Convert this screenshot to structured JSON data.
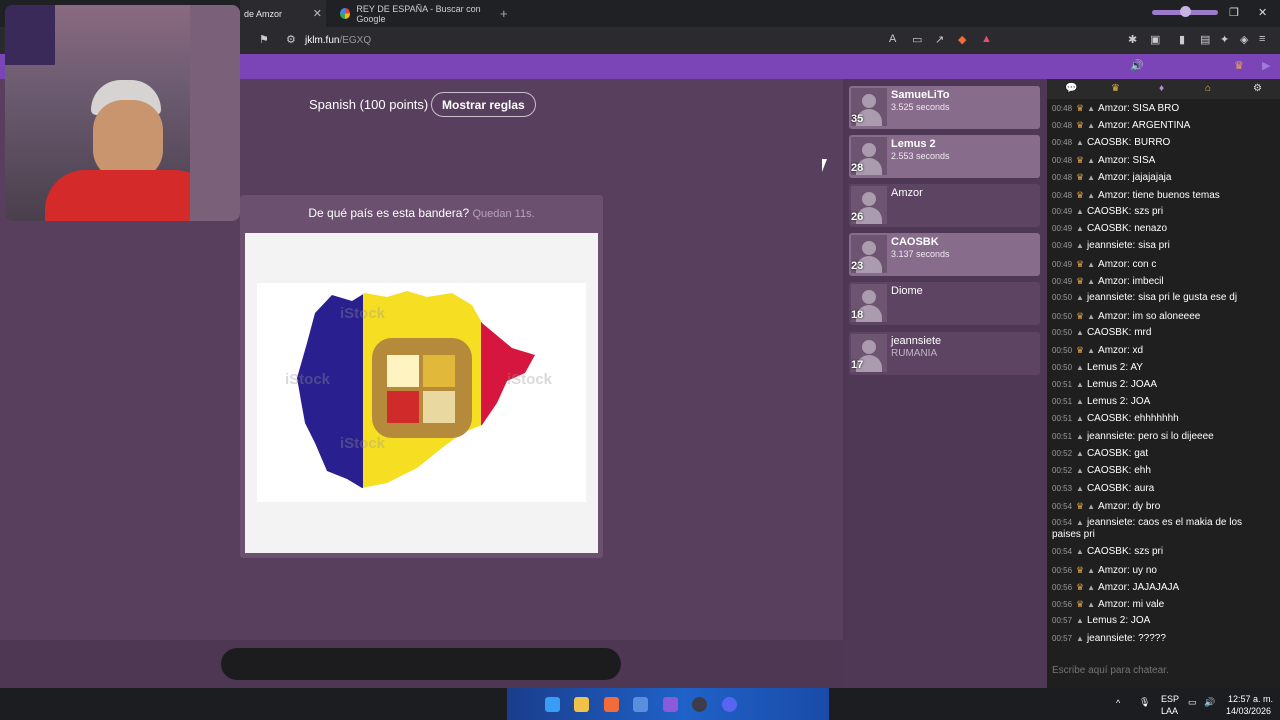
{
  "browser": {
    "tabs": [
      {
        "title": "de Amzor",
        "active": true
      },
      {
        "title": "REY DE ESPAÑA - Buscar con Google",
        "active": false
      }
    ],
    "url_host": "jklm.fun",
    "url_path": "/EGXQ"
  },
  "game": {
    "language_label": "Spanish (100 points)",
    "rules_button": "Mostrar reglas",
    "question": "De qué país es esta bandera?",
    "timer": "Quedan 11s.",
    "image_watermark": "iStock",
    "answer_input_placeholder": ""
  },
  "players": [
    {
      "name": "SamueLiTo",
      "detail": "3.525 seconds",
      "score": "35",
      "answered": true
    },
    {
      "name": "Lemus 2",
      "detail": "2.553 seconds",
      "score": "28",
      "answered": true
    },
    {
      "name": "Amzor",
      "detail": "",
      "score": "26",
      "answered": false
    },
    {
      "name": "CAOSBK",
      "detail": "3.137 seconds",
      "score": "23",
      "answered": true
    },
    {
      "name": "Diome",
      "detail": "",
      "score": "18",
      "answered": false
    },
    {
      "name": "jeannsiete",
      "detail": "RUMANIA",
      "score": "17",
      "answered": false
    }
  ],
  "chat": {
    "messages": [
      {
        "time": "00:48",
        "crown": true,
        "user": "Amzor",
        "text": "SISA BRO"
      },
      {
        "time": "00:48",
        "crown": true,
        "user": "Amzor",
        "text": "ARGENTINA"
      },
      {
        "time": "00:48",
        "crown": false,
        "user": "CAOSBK",
        "text": "BURRO"
      },
      {
        "time": "00:48",
        "crown": true,
        "user": "Amzor",
        "text": "SISA"
      },
      {
        "time": "00:48",
        "crown": true,
        "user": "Amzor",
        "text": "jajajajaja"
      },
      {
        "time": "00:48",
        "crown": true,
        "user": "Amzor",
        "text": "tiene buenos temas"
      },
      {
        "time": "00:49",
        "crown": false,
        "user": "CAOSBK",
        "text": "szs pri"
      },
      {
        "time": "00:49",
        "crown": false,
        "user": "CAOSBK",
        "text": "nenazo"
      },
      {
        "time": "00:49",
        "crown": false,
        "user": "jeannsiete",
        "text": "sisa pri"
      },
      {
        "time": "00:49",
        "crown": true,
        "user": "Amzor",
        "text": "con c"
      },
      {
        "time": "00:49",
        "crown": true,
        "user": "Amzor",
        "text": "imbecil"
      },
      {
        "time": "00:50",
        "crown": false,
        "user": "jeannsiete",
        "text": "sisa pri le gusta ese dj"
      },
      {
        "time": "00:50",
        "crown": true,
        "user": "Amzor",
        "text": "im so aloneeee"
      },
      {
        "time": "00:50",
        "crown": false,
        "user": "CAOSBK",
        "text": "mrd"
      },
      {
        "time": "00:50",
        "crown": true,
        "user": "Amzor",
        "text": "xd"
      },
      {
        "time": "00:50",
        "crown": false,
        "user": "Lemus 2",
        "text": "AY"
      },
      {
        "time": "00:51",
        "crown": false,
        "user": "Lemus 2",
        "text": "JOAA"
      },
      {
        "time": "00:51",
        "crown": false,
        "user": "Lemus 2",
        "text": "JOA"
      },
      {
        "time": "00:51",
        "crown": false,
        "user": "CAOSBK",
        "text": "ehhhhhhh"
      },
      {
        "time": "00:51",
        "crown": false,
        "user": "jeannsiete",
        "text": "pero si lo dijeeee"
      },
      {
        "time": "00:52",
        "crown": false,
        "user": "CAOSBK",
        "text": "gat"
      },
      {
        "time": "00:52",
        "crown": false,
        "user": "CAOSBK",
        "text": "ehh"
      },
      {
        "time": "00:53",
        "crown": false,
        "user": "CAOSBK",
        "text": "aura"
      },
      {
        "time": "00:54",
        "crown": true,
        "user": "Amzor",
        "text": "dy bro"
      },
      {
        "time": "00:54",
        "crown": false,
        "user": "jeannsiete",
        "text": "caos es el makia de los paises pri"
      },
      {
        "time": "00:54",
        "crown": false,
        "user": "CAOSBK",
        "text": "szs pri"
      },
      {
        "time": "00:56",
        "crown": true,
        "user": "Amzor",
        "text": "uy no"
      },
      {
        "time": "00:56",
        "crown": true,
        "user": "Amzor",
        "text": "JAJAJAJA"
      },
      {
        "time": "00:56",
        "crown": true,
        "user": "Amzor",
        "text": "mi vale"
      },
      {
        "time": "00:57",
        "crown": false,
        "user": "Lemus 2",
        "text": "JOA"
      },
      {
        "time": "00:57",
        "crown": false,
        "user": "jeannsiete",
        "text": "?????"
      }
    ],
    "input_placeholder": "Escribe aquí para chatear."
  },
  "taskbar": {
    "lang_top": "ESP",
    "lang_bottom": "LAA",
    "time": "12:57 a. m.",
    "date": "14/03/2026"
  }
}
